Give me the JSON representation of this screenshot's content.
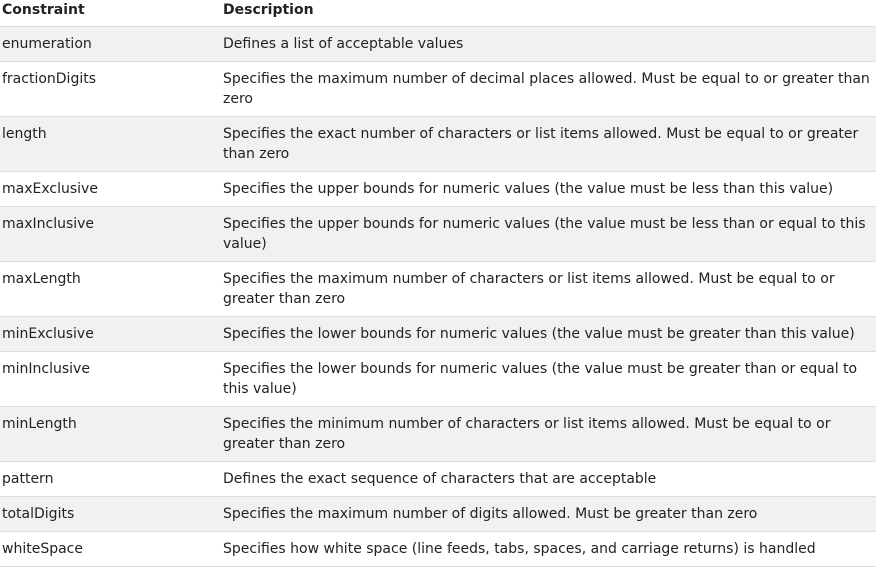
{
  "table": {
    "headers": {
      "constraint": "Constraint",
      "description": "Description"
    },
    "rows": [
      {
        "constraint": "enumeration",
        "description": "Defines a list of acceptable values"
      },
      {
        "constraint": "fractionDigits",
        "description": "Specifies the maximum number of decimal places allowed. Must be equal to or greater than zero"
      },
      {
        "constraint": "length",
        "description": "Specifies the exact number of characters or list items allowed. Must be equal to or greater than zero"
      },
      {
        "constraint": "maxExclusive",
        "description": "Specifies the upper bounds for numeric values (the value must be less than this value)"
      },
      {
        "constraint": "maxInclusive",
        "description": "Specifies the upper bounds for numeric values (the value must be less than or equal to this value)"
      },
      {
        "constraint": "maxLength",
        "description": "Specifies the maximum number of characters or list items allowed. Must be equal to or greater than zero"
      },
      {
        "constraint": "minExclusive",
        "description": "Specifies the lower bounds for numeric values (the value must be greater than this value)"
      },
      {
        "constraint": "minInclusive",
        "description": "Specifies the lower bounds for numeric values (the value must be greater than or equal to this value)"
      },
      {
        "constraint": "minLength",
        "description": "Specifies the minimum number of characters or list items allowed. Must be equal to or greater than zero"
      },
      {
        "constraint": "pattern",
        "description": "Defines the exact sequence of characters that are acceptable"
      },
      {
        "constraint": "totalDigits",
        "description": "Specifies the maximum number of digits allowed. Must be greater than zero"
      },
      {
        "constraint": "whiteSpace",
        "description": "Specifies how white space (line feeds, tabs, spaces, and carriage returns) is handled"
      }
    ]
  }
}
